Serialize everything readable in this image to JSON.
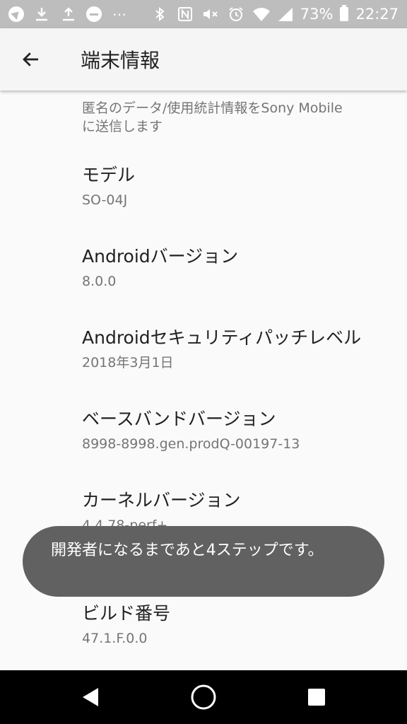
{
  "status_bar": {
    "battery": "73%",
    "time": "22:27"
  },
  "app_bar": {
    "title": "端末情報"
  },
  "items": [
    {
      "summary": "匿名のデータ/使用統計情報をSony Mobile\nに送信します"
    },
    {
      "title": "モデル",
      "summary": "SO-04J"
    },
    {
      "title": "Androidバージョン",
      "summary": "8.0.0"
    },
    {
      "title": "Androidセキュリティパッチレベル",
      "summary": "2018年3月1日"
    },
    {
      "title": "ベースバンドバージョン",
      "summary": "8998-8998.gen.prodQ-00197-13"
    },
    {
      "title": "カーネルバージョン",
      "summary": "4.4.78-perf+\nTue Feb 27 19:33:46 2018"
    },
    {
      "title": "ビルド番号",
      "summary": "47.1.F.0.0"
    }
  ],
  "toast": {
    "message": "開発者になるまであと4ステップです。"
  },
  "icons": {
    "back": "arrow-left-icon",
    "nav_back": "triangle-back-icon",
    "nav_home": "circle-home-icon",
    "nav_recents": "square-recents-icon"
  }
}
